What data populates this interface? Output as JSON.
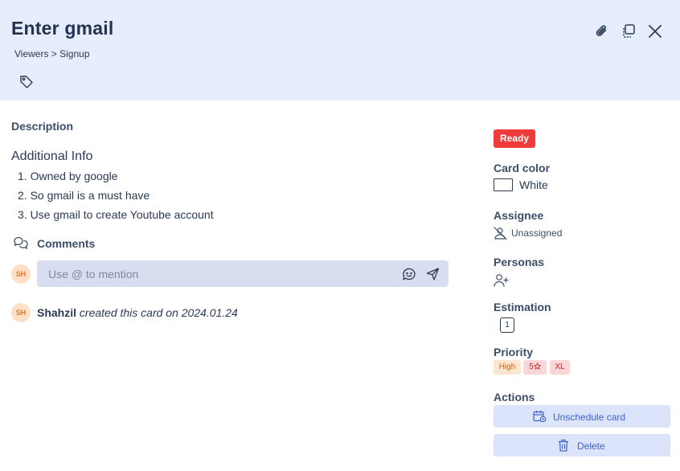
{
  "card": {
    "title": "Enter gmail",
    "breadcrumb": "Viewers > Signup"
  },
  "description": {
    "label": "Description",
    "heading": "Additional Info",
    "items": [
      "1. Owned by google",
      "2. So gmail is a must have",
      "3. Use gmail to create Youtube account"
    ]
  },
  "comments": {
    "label": "Comments",
    "avatar_initials": "SH",
    "placeholder": "Use @ to mention"
  },
  "activity": {
    "avatar_initials": "SH",
    "user": "Shahzil",
    "text": "created this card on 2024.01.24"
  },
  "sidebar": {
    "status": "Ready",
    "status_color": "#ef3b3b",
    "card_color_label": "Card color",
    "card_color_value": "White",
    "assignee_label": "Assignee",
    "assignee_value": "Unassigned",
    "personas_label": "Personas",
    "estimation_label": "Estimation",
    "estimation_value": "1",
    "priority_label": "Priority",
    "priority_level": "High",
    "priority_score": "5",
    "priority_size": "XL",
    "actions_label": "Actions",
    "unschedule_label": "Unschedule card",
    "delete_label": "Delete"
  },
  "colors": {
    "header_bg": "#e6edfd",
    "accent": "#3f64c8",
    "text": "#2b3a55"
  },
  "icons": [
    "tag-icon",
    "attachment-icon",
    "copy-icon",
    "close-icon",
    "comments-icon",
    "emoji-icon",
    "send-icon",
    "user-off-icon",
    "user-plus-icon",
    "star-icon",
    "calendar-clock-icon",
    "trash-icon"
  ]
}
